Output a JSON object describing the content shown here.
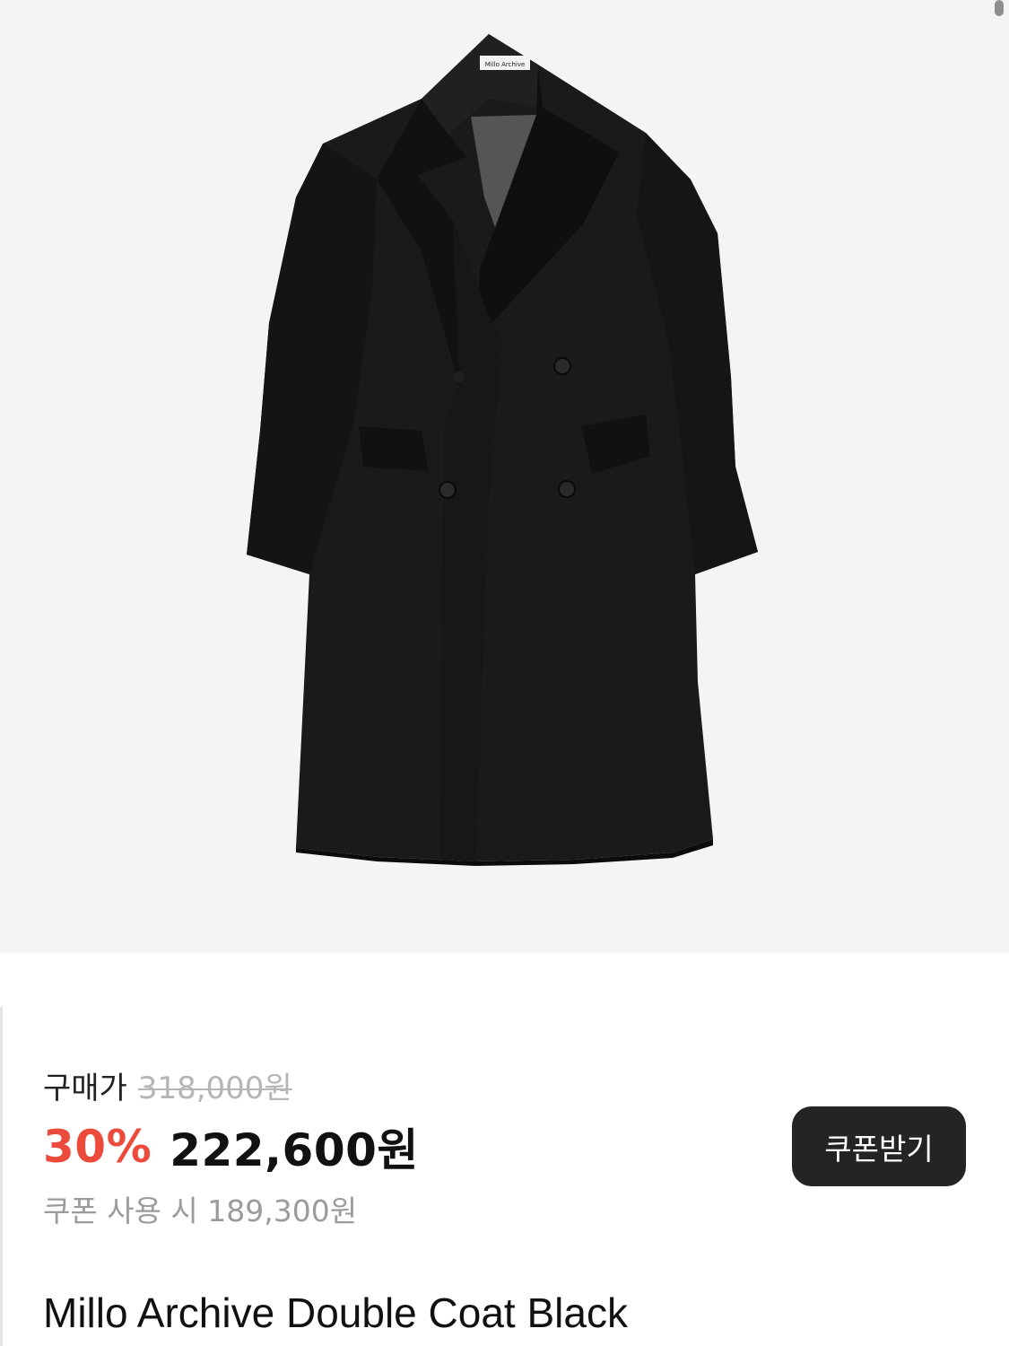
{
  "product": {
    "image_label": "Millo Archive",
    "purchase_label": "구매가",
    "original_price": "318,000원",
    "discount": "30%",
    "sale_price": "222,600원",
    "coupon_price_text": "쿠폰 사용 시 189,300원",
    "coupon_button_label": "쿠폰받기",
    "title": "Millo Archive Double Coat Black"
  },
  "colors": {
    "discount": "#ec4b3c",
    "button_bg": "#242424",
    "hero_bg": "#f4f4f4"
  }
}
